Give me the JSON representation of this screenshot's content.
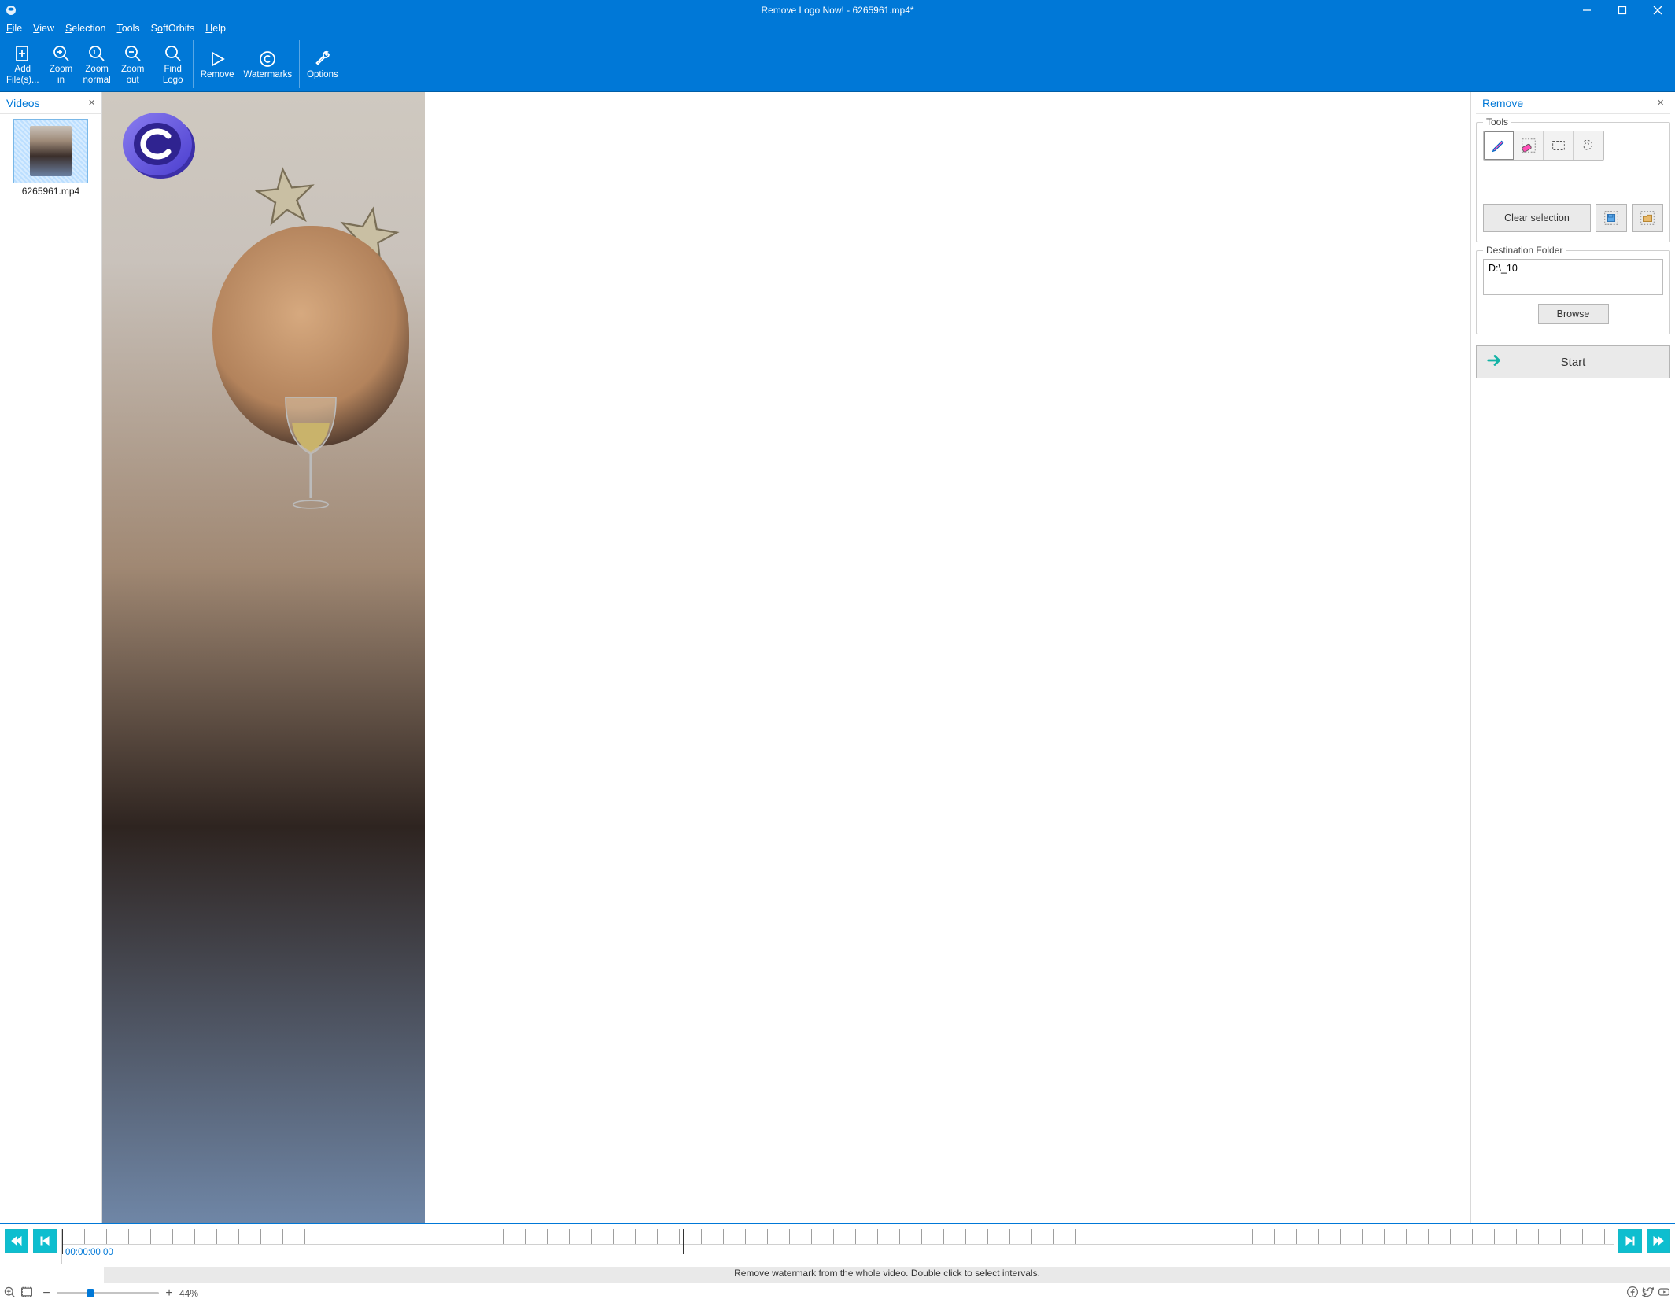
{
  "window": {
    "title": "Remove Logo Now! - 6265961.mp4*"
  },
  "menu": {
    "file": "File",
    "view": "View",
    "selection": "Selection",
    "tools": "Tools",
    "softorbits": "SoftOrbits",
    "help": "Help"
  },
  "toolbar": {
    "add_files": "Add\nFile(s)...",
    "zoom_in": "Zoom\nin",
    "zoom_normal": "Zoom\nnormal",
    "zoom_out": "Zoom\nout",
    "find_logo": "Find\nLogo",
    "remove": "Remove",
    "watermarks": "Watermarks",
    "options": "Options"
  },
  "videos_panel": {
    "title": "Videos",
    "items": [
      {
        "name": "6265961.mp4"
      }
    ]
  },
  "remove_panel": {
    "title": "Remove",
    "tools_legend": "Tools",
    "clear_selection": "Clear selection",
    "dest_legend": "Destination Folder",
    "dest_value": "D:\\_10",
    "browse": "Browse",
    "start": "Start"
  },
  "timeline": {
    "timecode": "00:00:00 00",
    "hint": "Remove watermark from the whole video. Double click to select intervals."
  },
  "statusbar": {
    "zoom_pct": "44%"
  }
}
